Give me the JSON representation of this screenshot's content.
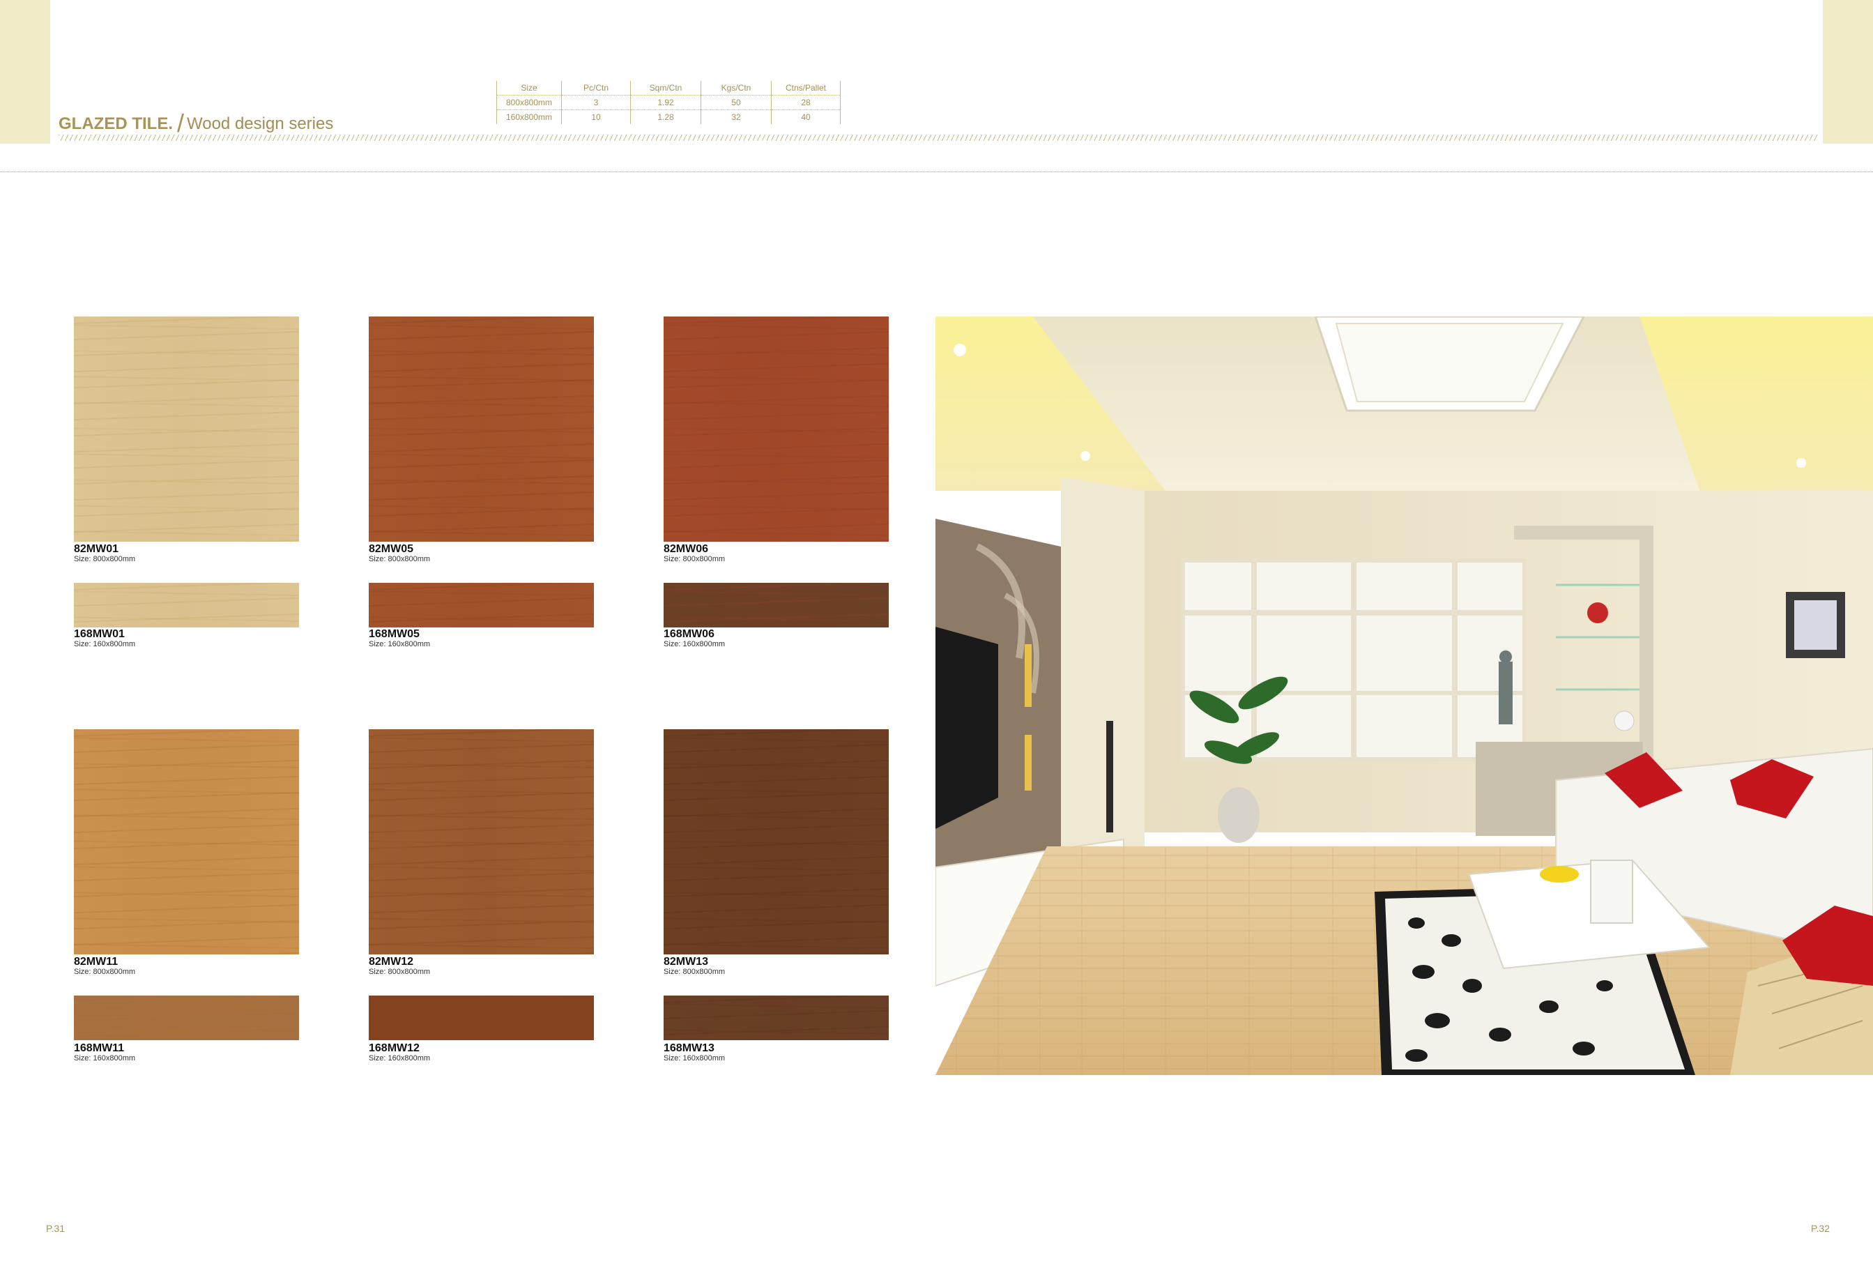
{
  "header": {
    "title": "GLAZED TILE.",
    "slash": "/",
    "subtitle": "Wood design series"
  },
  "spec_table": {
    "headers": [
      "Size",
      "Pc/Ctn",
      "Sqm/Ctn",
      "Kgs/Ctn",
      "Ctns/Pallet"
    ],
    "rows": [
      [
        "800x800mm",
        "3",
        "1.92",
        "50",
        "28"
      ],
      [
        "160x800mm",
        "10",
        "1.28",
        "32",
        "40"
      ]
    ]
  },
  "tiles": [
    {
      "code": "82MW01",
      "size": "Size: 800x800mm",
      "color": "#dcc493",
      "grain": "#c7a868",
      "strip_code": "168MW01",
      "strip_size": "Size: 160x800mm",
      "strip_color": "#dcc493"
    },
    {
      "code": "82MW05",
      "size": "Size: 800x800mm",
      "color": "#a6542c",
      "grain": "#8c4220",
      "strip_code": "168MW05",
      "strip_size": "Size: 160x800mm",
      "strip_color": "#a3532b"
    },
    {
      "code": "82MW06",
      "size": "Size: 800x800mm",
      "color": "#a4492a",
      "grain": "#8f3c22",
      "strip_code": "168MW06",
      "strip_size": "Size: 160x800mm",
      "strip_color": "#6b4127"
    },
    {
      "code": "82MW11",
      "size": "Size: 800x800mm",
      "color": "#cb904e",
      "grain": "#b07436",
      "strip_code": "168MW11",
      "strip_size": "Size: 160x800mm",
      "strip_color": "#a66f3f"
    },
    {
      "code": "82MW12",
      "size": "Size: 800x800mm",
      "color": "#9d5b30",
      "grain": "#83461f",
      "strip_code": "168MW12",
      "strip_size": "Size: 160x800mm",
      "strip_color": "#85421f"
    },
    {
      "code": "82MW13",
      "size": "Size: 800x800mm",
      "color": "#6e3e23",
      "grain": "#56301a",
      "strip_code": "168MW13",
      "strip_size": "Size: 160x800mm",
      "strip_color": "#6a3f26"
    }
  ],
  "page_numbers": {
    "left": "P.31",
    "right": "P.32"
  },
  "room_photo": {
    "label": "Living room interior with wood design floor tiles"
  },
  "colors": {
    "accent": "#a89457",
    "corner_band": "#f1ecc7"
  }
}
